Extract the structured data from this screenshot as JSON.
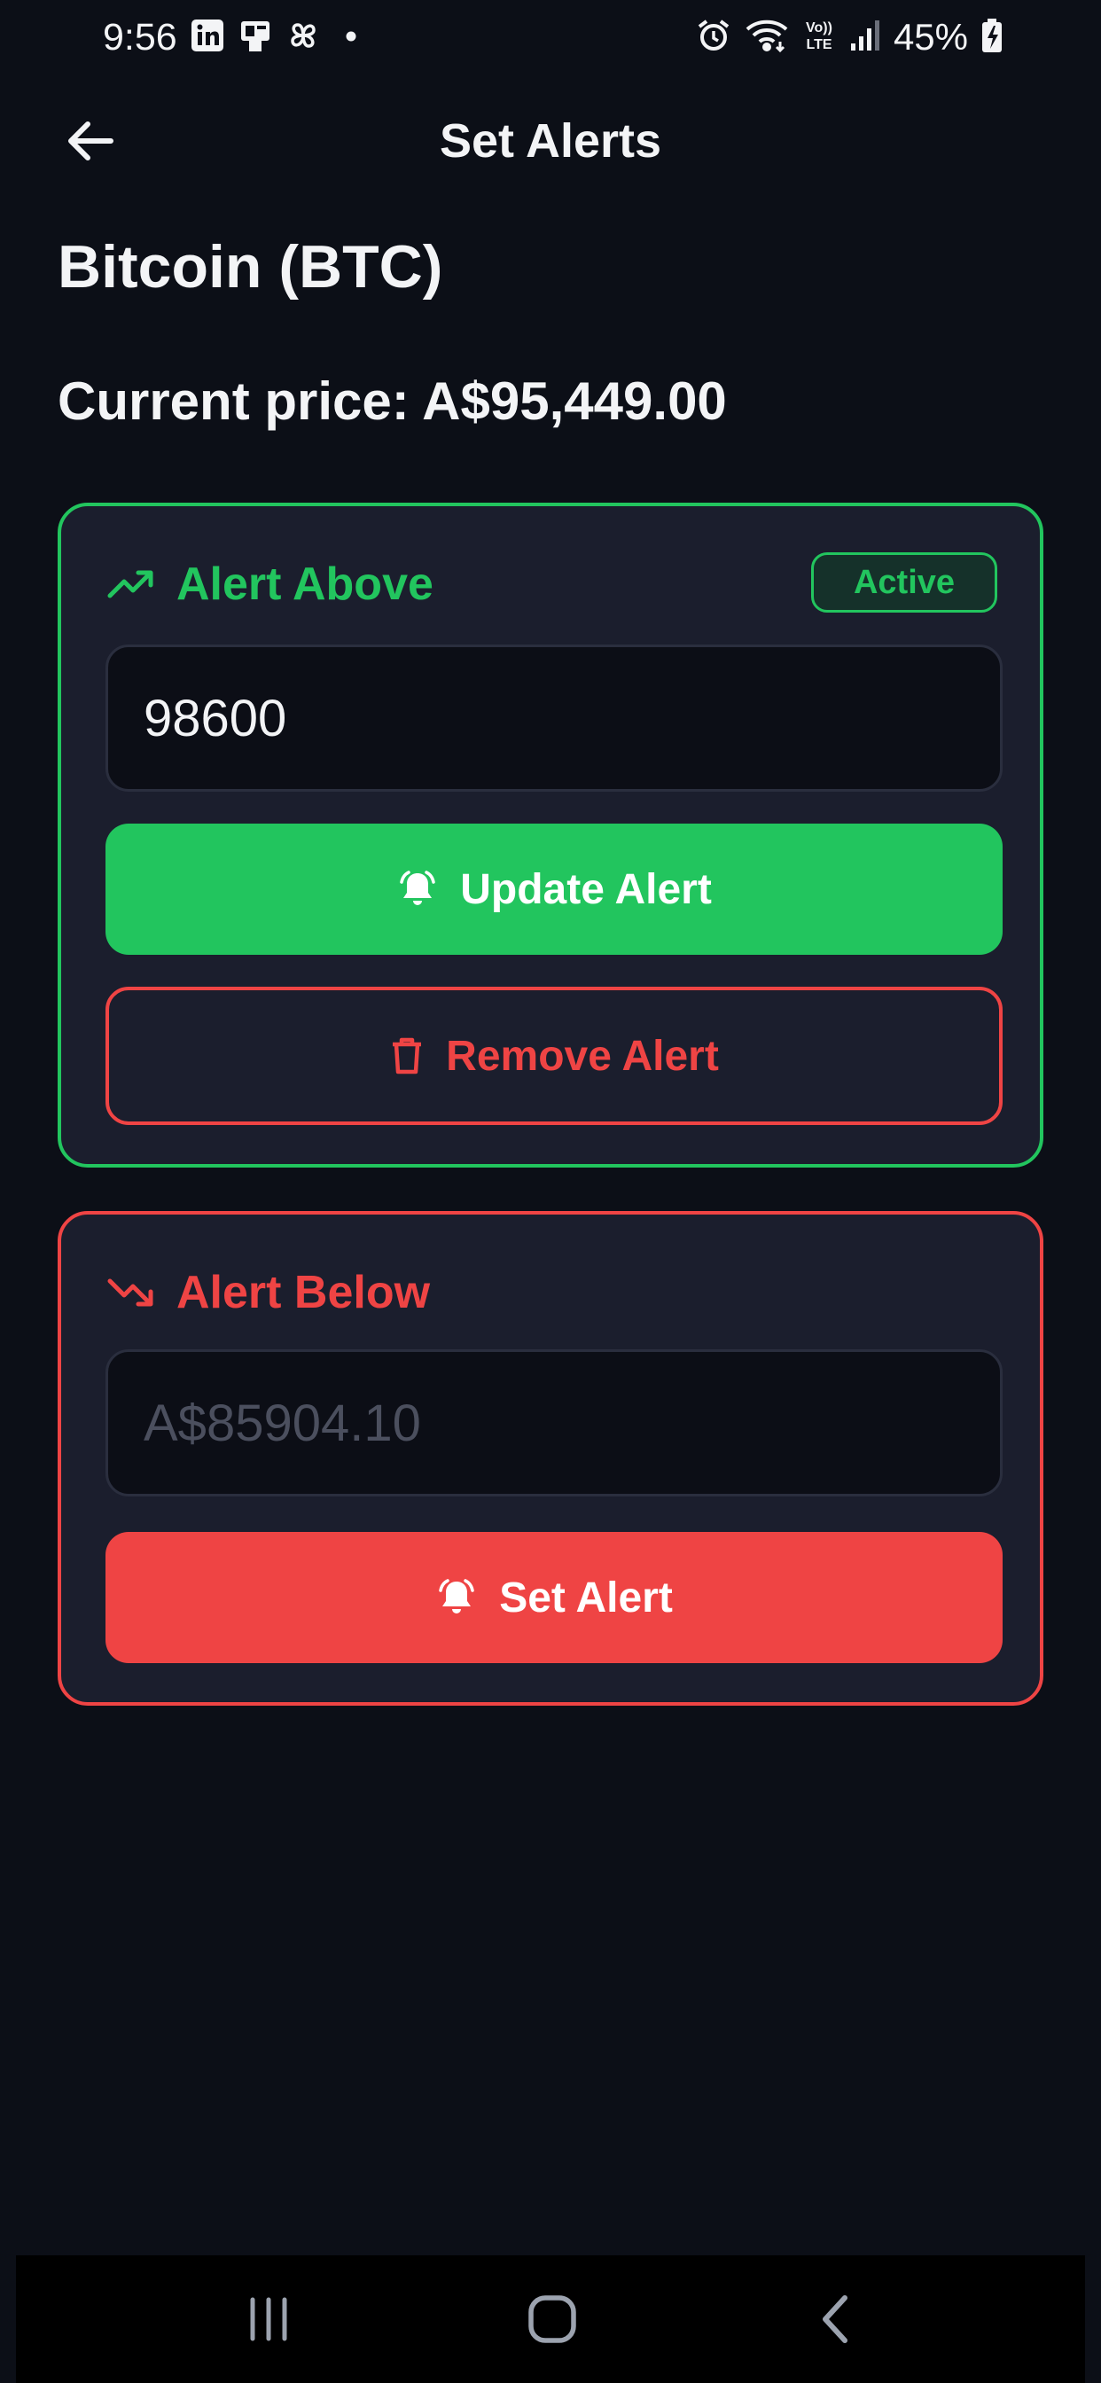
{
  "status_bar": {
    "time": "9:56",
    "left_icons": [
      "linkedin-icon",
      "sim-app-icon",
      "pinwheel-icon",
      "dot-icon"
    ],
    "right_icons": [
      "alarm-icon",
      "wifi-icon",
      "volte-icon",
      "signal-icon"
    ],
    "battery": "45%",
    "volte_label_top": "Vo))",
    "volte_label_bottom": "LTE"
  },
  "header": {
    "title": "Set Alerts",
    "back_icon": "arrow-left-icon"
  },
  "asset": {
    "name": "Bitcoin (BTC)",
    "current_price": "Current price: A$95,449.00"
  },
  "alert_above": {
    "icon": "trending-up-icon",
    "title": "Alert Above",
    "badge": "Active",
    "input_value": "98600",
    "update_label": "Update Alert",
    "remove_label": "Remove Alert",
    "accent": "#22c55e"
  },
  "alert_below": {
    "icon": "trending-down-icon",
    "title": "Alert Below",
    "input_placeholder": "A$85904.10",
    "set_label": "Set Alert",
    "accent": "#ef4444"
  },
  "colors": {
    "background": "#0c0f17",
    "card": "#1b1e2d",
    "green": "#22c55e",
    "red": "#ef4444"
  },
  "nav_bar": {
    "items": [
      "recents-icon",
      "home-icon",
      "back-icon"
    ]
  }
}
